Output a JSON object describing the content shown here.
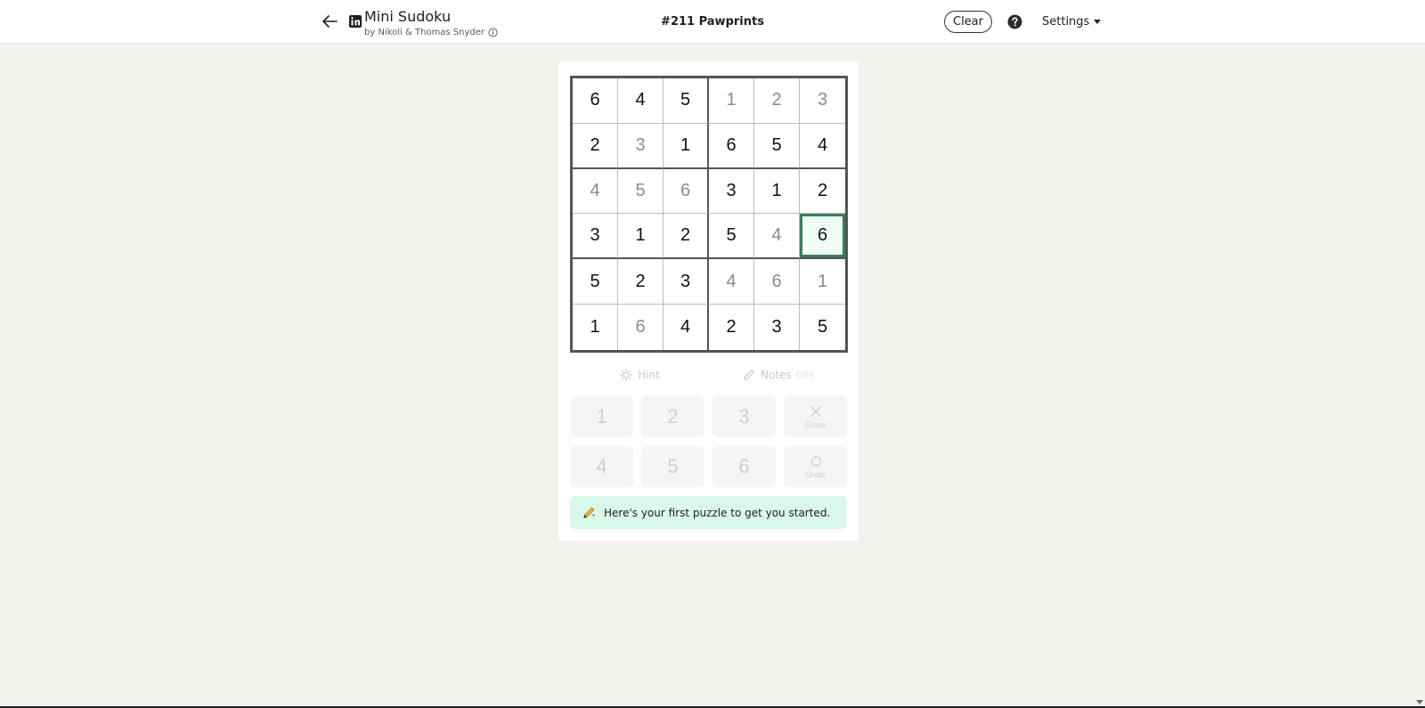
{
  "header": {
    "app_title": "Mini Sudoku",
    "byline": "by Nikoli & Thomas Snyder",
    "puzzle_name": "#211 Pawprints",
    "clear_label": "Clear",
    "settings_label": "Settings"
  },
  "icons": {
    "back": "arrow-left-icon",
    "logo": "linkedin-logo",
    "info": "info-icon",
    "help": "help-circle-icon",
    "hint": "lightbulb-icon",
    "notes": "pencil-icon",
    "erase": "x-icon",
    "undo": "undo-icon",
    "banner": "pencil-sparkle-icon"
  },
  "board": {
    "rows": [
      [
        {
          "v": "6",
          "t": "given"
        },
        {
          "v": "4",
          "t": "given"
        },
        {
          "v": "5",
          "t": "given"
        },
        {
          "v": "1",
          "t": "filled"
        },
        {
          "v": "2",
          "t": "filled"
        },
        {
          "v": "3",
          "t": "filled"
        }
      ],
      [
        {
          "v": "2",
          "t": "given"
        },
        {
          "v": "3",
          "t": "filled"
        },
        {
          "v": "1",
          "t": "given"
        },
        {
          "v": "6",
          "t": "given"
        },
        {
          "v": "5",
          "t": "given"
        },
        {
          "v": "4",
          "t": "given"
        }
      ],
      [
        {
          "v": "4",
          "t": "filled"
        },
        {
          "v": "5",
          "t": "filled"
        },
        {
          "v": "6",
          "t": "filled"
        },
        {
          "v": "3",
          "t": "given"
        },
        {
          "v": "1",
          "t": "given"
        },
        {
          "v": "2",
          "t": "given"
        }
      ],
      [
        {
          "v": "3",
          "t": "given"
        },
        {
          "v": "1",
          "t": "given"
        },
        {
          "v": "2",
          "t": "given"
        },
        {
          "v": "5",
          "t": "given"
        },
        {
          "v": "4",
          "t": "filled"
        },
        {
          "v": "6",
          "t": "given"
        }
      ],
      [
        {
          "v": "5",
          "t": "given"
        },
        {
          "v": "2",
          "t": "given"
        },
        {
          "v": "3",
          "t": "given"
        },
        {
          "v": "4",
          "t": "filled"
        },
        {
          "v": "6",
          "t": "filled"
        },
        {
          "v": "1",
          "t": "filled"
        }
      ],
      [
        {
          "v": "1",
          "t": "given"
        },
        {
          "v": "6",
          "t": "filled"
        },
        {
          "v": "4",
          "t": "given"
        },
        {
          "v": "2",
          "t": "given"
        },
        {
          "v": "3",
          "t": "given"
        },
        {
          "v": "5",
          "t": "given"
        }
      ]
    ],
    "selected_row": 3,
    "selected_col": 5
  },
  "tools": {
    "hint_label": "Hint",
    "notes_label": "Notes",
    "notes_state": "OFF"
  },
  "keypad": {
    "digits": [
      "1",
      "2",
      "3",
      "4",
      "5",
      "6"
    ],
    "erase_label": "Erase",
    "undo_label": "Undo"
  },
  "banner": {
    "text": "Here's your first puzzle to get you started."
  },
  "colors": {
    "selected_border": "#3a7d5c",
    "selected_fill": "#effdf6",
    "banner_bg": "#d9f8ec",
    "page_bg": "#f3f2ef"
  }
}
